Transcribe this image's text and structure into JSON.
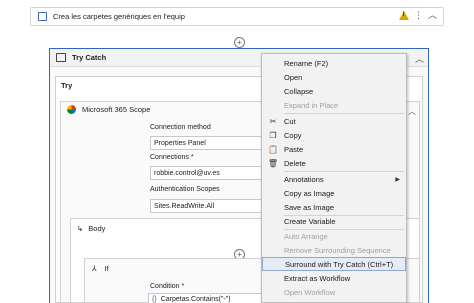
{
  "sequence": {
    "title": "Crea les carpetes genèriques en l'equip"
  },
  "try_catch": {
    "title": "Try Catch",
    "try_label": "Try"
  },
  "scope": {
    "title": "Microsoft 365 Scope",
    "connection_method_label": "Connection method",
    "connection_method_value": "Properties Panel",
    "connections_label": "Connections",
    "connections_required": "*",
    "connections_value": "robbie.control@uv.es",
    "auth_scopes_label": "Authentication Scopes",
    "auth_scopes_value": "Sites.ReadWrite.All"
  },
  "body": {
    "label": "Body"
  },
  "if_activity": {
    "label": "If",
    "condition_label": "Condition",
    "condition_required": "*",
    "condition_value": "Carpetas.Contains(\"-\")"
  },
  "context_menu": {
    "items": [
      {
        "label": "Rename (F2)",
        "enabled": true,
        "icon": ""
      },
      {
        "label": "Open",
        "enabled": true,
        "icon": ""
      },
      {
        "label": "Collapse",
        "enabled": true,
        "icon": ""
      },
      {
        "label": "Expand in Place",
        "enabled": false,
        "icon": ""
      },
      {
        "label": "Cut",
        "enabled": true,
        "icon": "cut-icon"
      },
      {
        "label": "Copy",
        "enabled": true,
        "icon": "copy-icon"
      },
      {
        "label": "Paste",
        "enabled": true,
        "icon": "paste-icon"
      },
      {
        "label": "Delete",
        "enabled": true,
        "icon": "trash-icon"
      },
      {
        "label": "Annotations",
        "enabled": true,
        "icon": "",
        "submenu": true
      },
      {
        "label": "Copy as Image",
        "enabled": true,
        "icon": ""
      },
      {
        "label": "Save as Image",
        "enabled": true,
        "icon": ""
      },
      {
        "label": "Create Variable",
        "enabled": true,
        "icon": ""
      },
      {
        "label": "Auto Arrange",
        "enabled": false,
        "icon": ""
      },
      {
        "label": "Remove Surrounding Sequence",
        "enabled": false,
        "icon": ""
      },
      {
        "label": "Surround with Try Catch (Ctrl+T)",
        "enabled": true,
        "icon": "",
        "highlighted": true
      },
      {
        "label": "Extract as Workflow",
        "enabled": true,
        "icon": ""
      },
      {
        "label": "Open Workflow",
        "enabled": false,
        "icon": ""
      }
    ]
  },
  "colors": {
    "selection_border": "#2f64c9",
    "warning": "#e2a400",
    "menu_highlight": "#e6ecf5"
  }
}
